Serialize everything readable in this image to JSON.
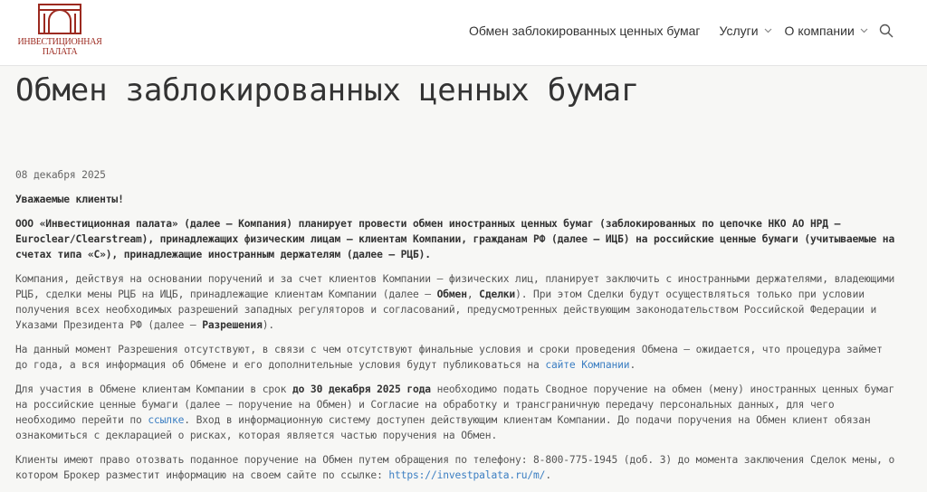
{
  "logo": {
    "line1": "ИНВЕСТИЦИОННАЯ",
    "line2": "ПАЛАТА",
    "color": "#9c2a20"
  },
  "nav": {
    "items": [
      {
        "label": "Обмен заблокированных ценных бумаг"
      },
      {
        "label": "Услуги"
      },
      {
        "label": "О компании"
      }
    ],
    "search_icon": "search-icon"
  },
  "page_title": "Обмен заблокированных ценных бумаг",
  "article": {
    "date": "08 декабря 2025",
    "greeting": "Уважаемые клиенты!",
    "lead": "ООО «Инвестиционная палата» (далее – Компания) планирует провести обмен иностранных ценных бумаг (заблокированных по цепочке НКО АО НРД – Euroclear/Clearstream), принадлежащих физическим лицам – клиентам Компании, гражданам РФ (далее – ИЦБ) на российские ценные бумаги (учитываемые на счетах типа «С»), принадлежащие иностранным держателям (далее – РЦБ).",
    "p1": {
      "t1": "Компания, действуя на основании поручений и за счет клиентов Компании – физических лиц, планирует заключить с иностранными держателями, владеющими РЦБ, сделки мены РЦБ на ИЦБ, принадлежащие клиентам Компании (далее – ",
      "b1": "Обмен",
      "t2": ", ",
      "b2": "Сделки",
      "t3": "). При этом Сделки будут осуществляться только при условии получения всех необходимых разрешений западных регуляторов и согласований, предусмотренных действующим законодательством Российской Федерации и Указами Президента РФ (далее – ",
      "b3": "Разрешения",
      "t4": ")."
    },
    "p2": {
      "t1": "На данный момент Разрешения отсутствуют, в связи с чем отсутствуют финальные условия и сроки проведения Обмена – ожидается, что процедура займет до года, а вся информация об Обмене и его дополнительные условия будут публиковаться на ",
      "link": "сайте Компании",
      "t2": "."
    },
    "p3": {
      "t1": "Для участия в Обмене клиентам Компании в срок ",
      "bold": "до 30 декабря 2025 года",
      "t2": " необходимо подать Сводное поручение на обмен (мену) иностранных ценных бумаг на российские ценные бумаги (далее – поручение на Обмен) и Согласие на обработку и трансграничную передачу персональных данных, для чего необходимо перейти по ",
      "link": "ссылке",
      "t3": ". Вход в информационную систему доступен действующим клиентам Компании. До подачи поручения на Обмен клиент обязан ознакомиться с декларацией о рисках, которая является частью поручения на Обмен."
    },
    "p4": {
      "t1": "Клиенты имеют право отозвать поданное поручение на Обмен путем обращения по телефону: 8-800-775-1945 (доб. 3) до момента заключения Сделок мены, о котором Брокер разместит информацию на своем сайте по ссылке: ",
      "link": "https://investpalata.ru/m/",
      "t2": "."
    }
  },
  "colors": {
    "brand": "#9c2a20",
    "link": "#3b7ec2",
    "background": "#f7f7f5"
  }
}
